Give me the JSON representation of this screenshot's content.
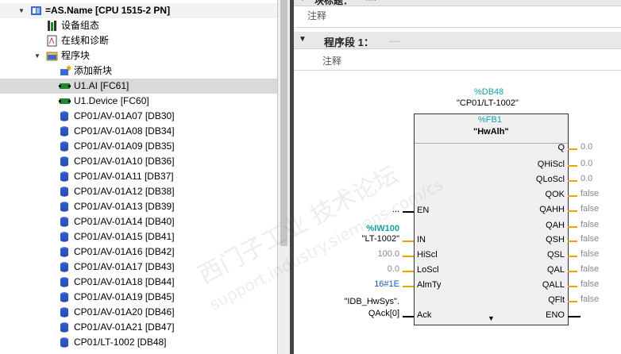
{
  "tree": {
    "rows": [
      {
        "label": "=AS.Name [CPU 1515-2 PN]",
        "icon": "plc-station-icon"
      },
      {
        "label": "设备组态",
        "icon": "device-config-icon"
      },
      {
        "label": "在线和诊断",
        "icon": "online-diagnostics-icon"
      },
      {
        "label": "程序块",
        "icon": "folder-icon"
      },
      {
        "label": "添加新块",
        "icon": "add-block-icon"
      },
      {
        "label": "U1.AI [FC61]",
        "icon": "fc-block-icon"
      },
      {
        "label": "U1.Device [FC60]",
        "icon": "fc-block-icon"
      },
      {
        "label": "CP01/AV-01A07 [DB30]",
        "icon": "db-icon"
      },
      {
        "label": "CP01/AV-01A08 [DB34]",
        "icon": "db-icon"
      },
      {
        "label": "CP01/AV-01A09 [DB35]",
        "icon": "db-icon"
      },
      {
        "label": "CP01/AV-01A10 [DB36]",
        "icon": "db-icon"
      },
      {
        "label": "CP01/AV-01A11 [DB37]",
        "icon": "db-icon"
      },
      {
        "label": "CP01/AV-01A12 [DB38]",
        "icon": "db-icon"
      },
      {
        "label": "CP01/AV-01A13 [DB39]",
        "icon": "db-icon"
      },
      {
        "label": "CP01/AV-01A14 [DB40]",
        "icon": "db-icon"
      },
      {
        "label": "CP01/AV-01A15 [DB41]",
        "icon": "db-icon"
      },
      {
        "label": "CP01/AV-01A16 [DB42]",
        "icon": "db-icon"
      },
      {
        "label": "CP01/AV-01A17 [DB43]",
        "icon": "db-icon"
      },
      {
        "label": "CP01/AV-01A18 [DB44]",
        "icon": "db-icon"
      },
      {
        "label": "CP01/AV-01A19 [DB45]",
        "icon": "db-icon"
      },
      {
        "label": "CP01/AV-01A20 [DB46]",
        "icon": "db-icon"
      },
      {
        "label": "CP01/AV-01A21 [DB47]",
        "icon": "db-icon"
      },
      {
        "label": "CP01/LT-1002 [DB48]",
        "icon": "db-icon"
      }
    ]
  },
  "editor": {
    "block_title": "块标题：",
    "block_title_dots": ".....",
    "comment1": "注释",
    "network_title": "程序段 1：",
    "network_dots": ".....",
    "comment2": "注释",
    "fb": {
      "instance_db": "%DB48",
      "instance_name": "\"CP01/LT-1002\"",
      "fb_number": "%FB1",
      "fb_name": "\"HwAlh\"",
      "inputs": [
        {
          "pin": "EN",
          "value": "...",
          "color": "black"
        },
        {
          "pin": "IN",
          "value": "\"LT-1002\"",
          "addr": "%IW100",
          "color": "orange"
        },
        {
          "pin": "HiScl",
          "value": "100.0",
          "color": "orange"
        },
        {
          "pin": "LoScl",
          "value": "0.0",
          "color": "orange"
        },
        {
          "pin": "AlmTy",
          "value": "16#1E",
          "color": "orange"
        },
        {
          "pin": "Ack",
          "value": "\"IDB_HwSys\".",
          "value2": "QAck[0]",
          "color": "black"
        }
      ],
      "outputs": [
        {
          "pin": "Q",
          "value": "0.0"
        },
        {
          "pin": "QHiScl",
          "value": "0.0"
        },
        {
          "pin": "QLoScl",
          "value": "0.0"
        },
        {
          "pin": "QOK",
          "value": "false"
        },
        {
          "pin": "QAHH",
          "value": "false"
        },
        {
          "pin": "QAH",
          "value": "false"
        },
        {
          "pin": "QSH",
          "value": "false"
        },
        {
          "pin": "QSL",
          "value": "false"
        },
        {
          "pin": "QAL",
          "value": "false"
        },
        {
          "pin": "QALL",
          "value": "false"
        },
        {
          "pin": "QFlt",
          "value": "false"
        },
        {
          "pin": "ENO",
          "value": ""
        }
      ]
    }
  },
  "watermark": {
    "line1": "西门子工业 技术论坛",
    "line2": "support.industry.siemens.com/cs"
  },
  "colors": {
    "accent_teal": "#16a0a0",
    "wire_orange": "#f0a000",
    "selected_row": "#d9d9d9",
    "value_gray": "#888888",
    "value_blue": "#1a5fb4"
  }
}
